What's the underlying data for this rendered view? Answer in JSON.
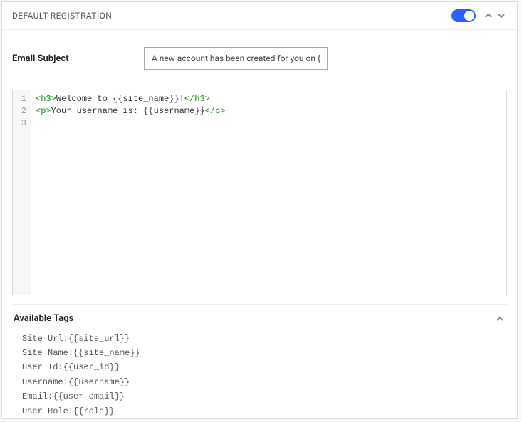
{
  "header": {
    "title": "DEFAULT REGISTRATION",
    "toggle_on": true
  },
  "email_subject": {
    "label": "Email Subject",
    "value": "A new account has been created for you on {{site_name}}"
  },
  "editor": {
    "lines": [
      {
        "raw": "<h3>Welcome to {{site_name}}!</h3>",
        "tokens": [
          [
            "tag",
            "<h3>"
          ],
          [
            "txt",
            "Welcome to {{site_name}}!"
          ],
          [
            "tag",
            "</h3>"
          ]
        ]
      },
      {
        "raw": "<p>Your username is: {{username}}</p>",
        "tokens": [
          [
            "tag",
            "<p>"
          ],
          [
            "txt",
            "Your username is: {{username}}"
          ],
          [
            "tag",
            "</p>"
          ]
        ]
      },
      {
        "raw": "",
        "tokens": []
      }
    ]
  },
  "available_tags": {
    "title": "Available Tags",
    "items": [
      "Site Url:{{site_url}}",
      "Site Name:{{site_name}}",
      "User Id:{{user_id}}",
      "Username:{{username}}",
      "Email:{{user_email}}",
      "User Role:{{role}}"
    ]
  }
}
